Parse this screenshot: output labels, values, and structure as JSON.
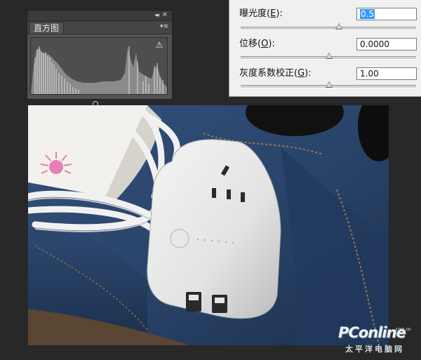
{
  "histogram_panel": {
    "tab_label": "直方图",
    "collapse_glyph": "◂◂",
    "close_glyph": "✕",
    "menu_glyph": "▾≡",
    "warning_glyph": "⚠",
    "icons": [
      "collapse-icon",
      "close-icon",
      "panel-menu-icon",
      "warning-icon"
    ]
  },
  "exposure_dialog": {
    "rows": [
      {
        "label": "曝光度",
        "mnemonic": "E",
        "value": "0.5",
        "slider_fraction": 0.56
      },
      {
        "label": "位移",
        "mnemonic": "O",
        "value": "0.0000",
        "slider_fraction": 0.5
      },
      {
        "label": "灰度系数校正",
        "mnemonic": "G",
        "value": "1.00",
        "slider_fraction": 0.5
      }
    ]
  },
  "watermark": {
    "brand": "PConline",
    "domain_text": ".com.cn",
    "chinese": "太平洋电脑网"
  },
  "colors": {
    "panel_bg": "#535353",
    "dialog_bg": "#f0f0f0",
    "selection": "#3399ff",
    "denim": "#2b4266"
  }
}
